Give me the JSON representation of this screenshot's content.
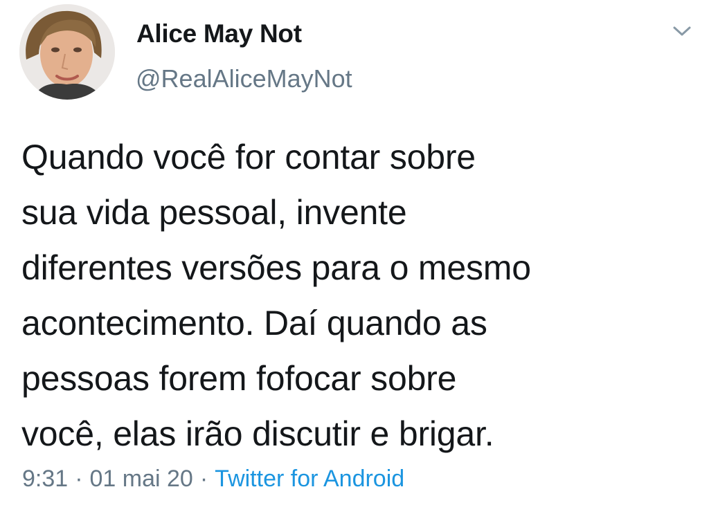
{
  "tweet": {
    "author": {
      "display_name": "Alice May Not",
      "handle": "@RealAliceMayNot"
    },
    "text": "Quando você for contar sobre\nsua vida pessoal, invente\ndiferentes versões para o mesmo\nacontecimento. Daí quando as\npessoas forem fofocar sobre\nvocê, elas irão discutir e brigar.",
    "time": "9:31",
    "separator": "·",
    "date": "01 mai 20",
    "source": "Twitter for Android",
    "menu_icon": "chevron-down-icon"
  },
  "colors": {
    "text": "#14171a",
    "secondary": "#657786",
    "link": "#1b95e0",
    "background": "#ffffff"
  }
}
